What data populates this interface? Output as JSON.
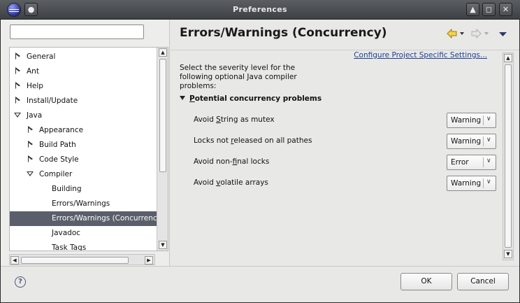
{
  "window": {
    "title": "Preferences",
    "controls": [
      "▲",
      "◻",
      "✕"
    ]
  },
  "filter": {
    "value": "",
    "placeholder": ""
  },
  "tree": {
    "items": [
      {
        "label": "General",
        "level": 0,
        "state": "closed"
      },
      {
        "label": "Ant",
        "level": 0,
        "state": "closed"
      },
      {
        "label": "Help",
        "level": 0,
        "state": "closed"
      },
      {
        "label": "Install/Update",
        "level": 0,
        "state": "closed"
      },
      {
        "label": "Java",
        "level": 0,
        "state": "open"
      },
      {
        "label": "Appearance",
        "level": 1,
        "state": "closed"
      },
      {
        "label": "Build Path",
        "level": 1,
        "state": "closed"
      },
      {
        "label": "Code Style",
        "level": 1,
        "state": "closed"
      },
      {
        "label": "Compiler",
        "level": 1,
        "state": "open"
      },
      {
        "label": "Building",
        "level": 2,
        "state": "leaf"
      },
      {
        "label": "Errors/Warnings",
        "level": 2,
        "state": "leaf"
      },
      {
        "label": "Errors/Warnings (Concurrency)",
        "level": 2,
        "state": "leaf",
        "selected": true
      },
      {
        "label": "Javadoc",
        "level": 2,
        "state": "leaf"
      },
      {
        "label": "Task Tags",
        "level": 2,
        "state": "leaf"
      }
    ]
  },
  "page": {
    "title": "Errors/Warnings (Concurrency)",
    "configure_link": "Configure Project Specific Settings...",
    "description": "Select the severity level for the following optional Java compiler problems:",
    "section_title_prefix": "P",
    "section_title_rest": "otential concurrency problems",
    "options": [
      {
        "pre": "Avoid ",
        "mnemonic": "S",
        "post": "tring as mutex",
        "value": "Warning"
      },
      {
        "pre": "Locks not ",
        "mnemonic": "r",
        "post": "eleased on all pathes",
        "value": "Warning"
      },
      {
        "pre": "Avoid non-",
        "mnemonic": "f",
        "post": "inal locks",
        "value": "Error"
      },
      {
        "pre": "Avoid ",
        "mnemonic": "v",
        "post": "olatile arrays",
        "value": "Warning"
      }
    ]
  },
  "buttons": {
    "ok": "OK",
    "cancel": "Cancel"
  },
  "colors": {
    "selection": "#5a5f6b",
    "link": "#1c3f94",
    "nav_arrow": "#e8b820"
  }
}
